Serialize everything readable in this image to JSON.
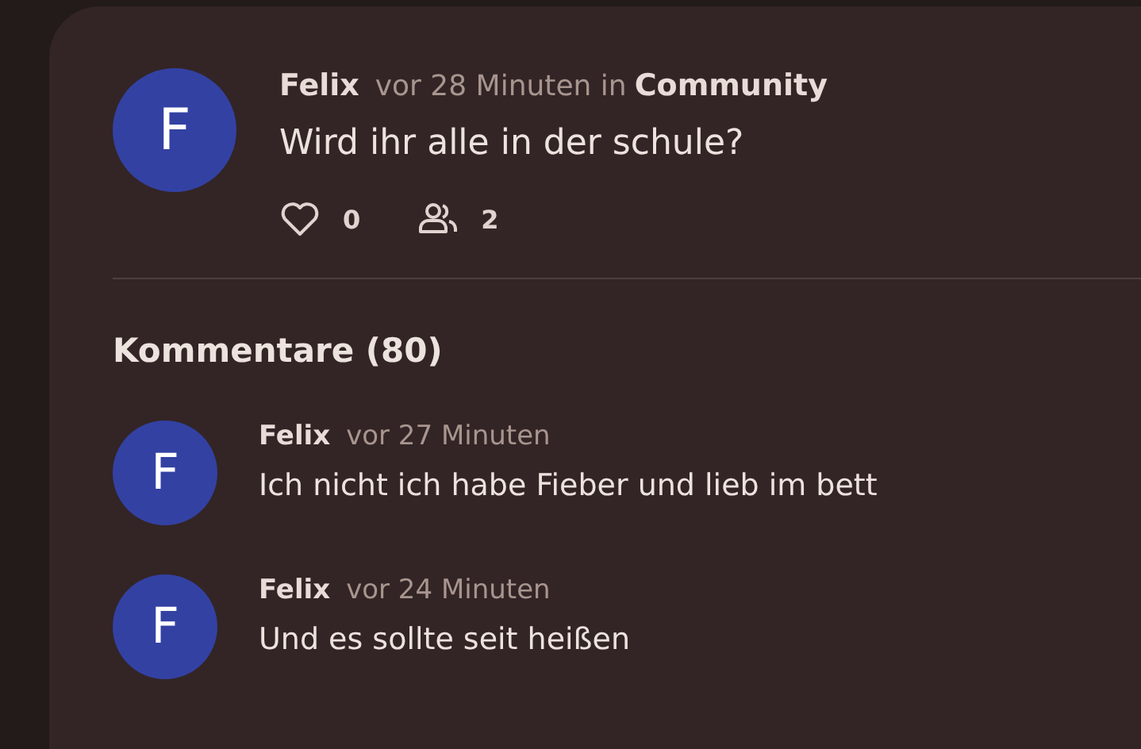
{
  "post": {
    "avatar": "F",
    "author": "Felix",
    "time": "vor 28 Minuten in",
    "community": "Community",
    "text": "Wird ihr alle in der schule?",
    "likes": "0",
    "participants": "2"
  },
  "comments_heading": "Kommentare (80)",
  "comments": [
    {
      "avatar": "F",
      "author": "Felix",
      "time": "vor 27 Minuten",
      "text": "Ich nicht ich habe Fieber und lieb im bett"
    },
    {
      "avatar": "F",
      "author": "Felix",
      "time": "vor 24 Minuten",
      "text": "Und es sollte seit heißen"
    }
  ]
}
